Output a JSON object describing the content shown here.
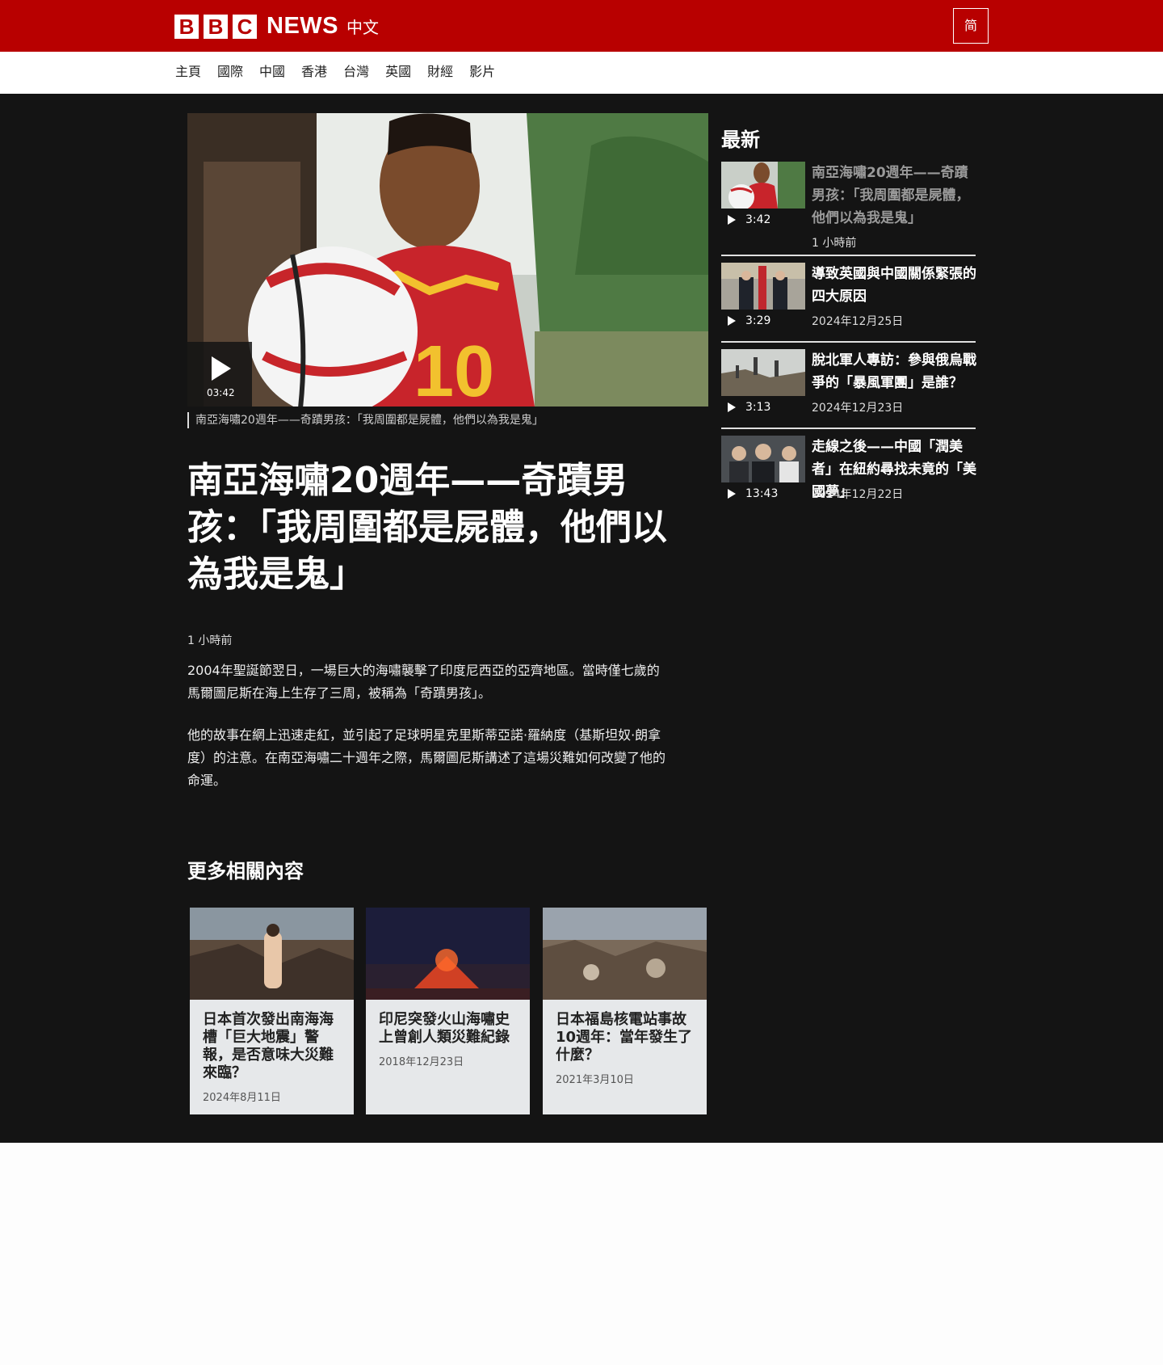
{
  "header": {
    "logo_letters": [
      "B",
      "B",
      "C"
    ],
    "logo_news": "NEWS",
    "logo_zh": "中文",
    "lang_toggle": "简"
  },
  "nav": {
    "items": [
      "主頁",
      "國際",
      "中國",
      "香港",
      "台灣",
      "英國",
      "財經",
      "影片"
    ]
  },
  "article": {
    "video_duration": "03:42",
    "caption": "南亞海嘯20週年——奇蹟男孩：「我周圍都是屍體，他們以為我是鬼」",
    "headline": "南亞海嘯20週年——奇蹟男孩：「我周圍都是屍體，他們以為我是鬼」",
    "time": "1 小時前",
    "paragraphs": [
      "2004年聖誕節翌日，一場巨大的海嘯襲擊了印度尼西亞的亞齊地區。當時僅七歲的馬爾圖尼斯在海上生存了三周，被稱為「奇蹟男孩」。",
      "他的故事在網上迅速走紅，並引起了足球明星克里斯蒂亞諾·羅納度（基斯坦奴·朗拿度）的注意。在南亞海嘯二十週年之際，馬爾圖尼斯講述了這場災難如何改變了他的命運。"
    ]
  },
  "related": {
    "title": "更多相關內容",
    "cards": [
      {
        "title": "日本首次發出南海海槽「巨大地震」警報，是否意味大災難來臨？",
        "date": "2024年8月11日"
      },
      {
        "title": "印尼突發火山海嘯史上曾創人類災難紀錄",
        "date": "2018年12月23日"
      },
      {
        "title": "日本福島核電站事故10週年：當年發生了什麼？",
        "date": "2021年3月10日"
      }
    ]
  },
  "sidebar": {
    "title": "最新",
    "items": [
      {
        "title": "南亞海嘯20週年——奇蹟男孩：「我周圍都是屍體，他們以為我是鬼」",
        "duration": "3:42",
        "date": "1 小時前"
      },
      {
        "title": "導致英國與中國關係緊張的四大原因",
        "duration": "3:29",
        "date": "2024年12月25日"
      },
      {
        "title": "脫北軍人專訪：參與俄烏戰爭的「暴風軍團」是誰？",
        "duration": "3:13",
        "date": "2024年12月23日"
      },
      {
        "title": "走線之後——中國「潤美者」在紐約尋找未竟的「美國夢」",
        "duration": "13:43",
        "date": "2024年12月22日"
      }
    ]
  }
}
